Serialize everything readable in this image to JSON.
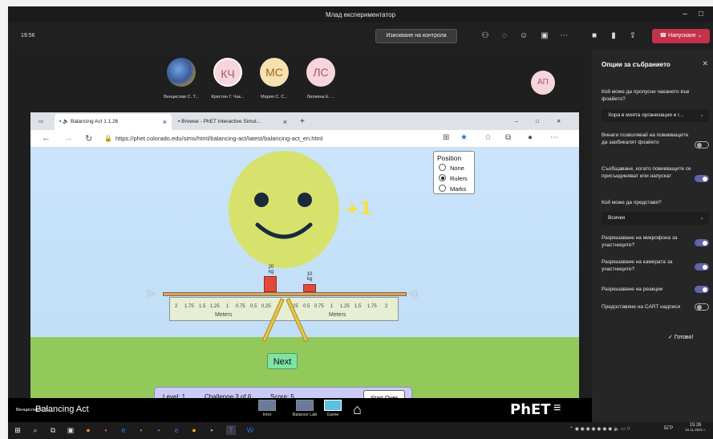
{
  "teams": {
    "window_title": "Млад експериментатор",
    "time": "19:56",
    "stop_control_label": "Изискване на контрола",
    "leave_label": "Напускане",
    "participants": [
      {
        "initials": "",
        "name": "Венцислав С. Т..."
      },
      {
        "initials": "КЧ",
        "name": "Кристин Г. Чак..."
      },
      {
        "initials": "МС",
        "name": "Мария С. С..."
      },
      {
        "initials": "ЛС",
        "name": "Лилияна Е. ..."
      }
    ],
    "extra_participant": "АП",
    "presenter_caption": "Венцислав С. Т..."
  },
  "options_panel": {
    "title": "Опции за събранието",
    "lobby_question": "Кой може да пропусне чакането във фоайето?",
    "lobby_value": "Хора в моята организация и г...",
    "always_let_callers": "Винаги позволявай на повикващите да заобикалят фоайето",
    "announce_join": "Съобщаване, когато повикващите се присъединяват или напускат",
    "presenter_question": "Кой може да представя?",
    "presenter_value": "Всички",
    "allow_mic": "Разрешаване на микрофона за участниците?",
    "allow_camera": "Разрешаване на камерата за участниците?",
    "allow_reactions": "Разрешаване на реакции",
    "cart_captions": "Предоставяне на CART надписи",
    "done_label": "Готово!",
    "toggles": {
      "always_let_callers": false,
      "announce_join": true,
      "allow_mic": true,
      "allow_camera": true,
      "allow_reactions": true,
      "cart_captions": false
    }
  },
  "browser": {
    "tabs": [
      {
        "label": "Balancing Act 1.1.26"
      },
      {
        "label": "Browse - PhET Interactive Simul..."
      }
    ],
    "url": "https://phet.colorado.edu/sims/html/balancing-act/latest/balancing-act_en.html"
  },
  "sim": {
    "feedback": "+1",
    "position_title": "Position",
    "position_options": [
      "None",
      "Rulers",
      "Marks"
    ],
    "position_selected": "Rulers",
    "ruler_ticks_left": [
      "2",
      "1.75",
      "1.5",
      "1.25",
      "1",
      "0.75",
      "0.5",
      "0.25"
    ],
    "ruler_ticks_right": [
      "0.25",
      "0.5",
      "0.75",
      "1",
      "1.25",
      "1.5",
      "1.75",
      "2"
    ],
    "ruler_unit": "Meters",
    "left_mass_label": "20 kg",
    "left_mass_number": "20",
    "right_mass_number": "10",
    "kg_unit": "kg",
    "next_label": "Next",
    "level": "Level: 1",
    "challenge": "Challenge 3 of 6",
    "score": "Score: 5",
    "start_over": "Start Over",
    "title": "Balancing Act",
    "screens": [
      "Intro",
      "Balance Lab",
      "Game"
    ],
    "active_screen": "Game",
    "brand": "PhET"
  },
  "taskbar": {
    "lang": "БГР",
    "time": "15:26",
    "date": "16.11.2021 г."
  }
}
